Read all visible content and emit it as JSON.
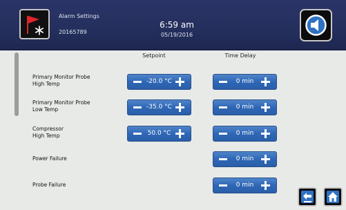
{
  "header": {
    "title": "Alarm Settings",
    "serial": "20165789",
    "time": "6:59 am",
    "date": "05/19/2016",
    "logo_icon": "alarm-flag-snowflake-icon",
    "speaker_icon": "speaker-icon"
  },
  "columns": {
    "setpoint": "Setpoint",
    "time_delay": "Time Delay"
  },
  "rows": [
    {
      "label_line1": "Primary Monitor Probe",
      "label_line2": "High Temp",
      "setpoint": "-20.0 °C",
      "delay": "0 min"
    },
    {
      "label_line1": "Primary Monitor Probe",
      "label_line2": "Low Temp",
      "setpoint": "-35.0 °C",
      "delay": "0 min"
    },
    {
      "label_line1": "Compressor",
      "label_line2": "High Temp",
      "setpoint": "50.0 °C",
      "delay": "0 min"
    },
    {
      "label_line1": "Power Failure",
      "label_line2": "",
      "setpoint": null,
      "delay": "0 min"
    },
    {
      "label_line1": "Probe Failure",
      "label_line2": "",
      "setpoint": null,
      "delay": "0 min"
    }
  ],
  "footer": {
    "back_icon": "back-arrow-icon",
    "home_icon": "home-icon"
  },
  "colors": {
    "header": "#25305e",
    "content_bg": "#e8eae8",
    "stepper": "#2f67b6",
    "flag_red": "#e0252b"
  }
}
